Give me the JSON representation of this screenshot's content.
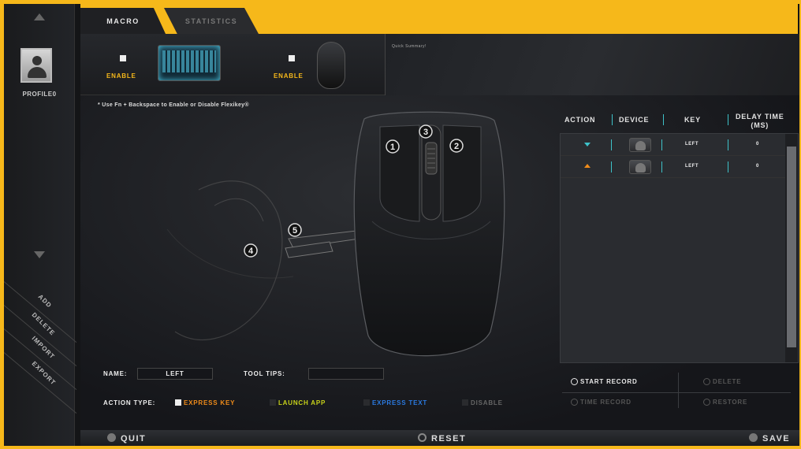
{
  "tabs": {
    "macro": "MACRO",
    "statistics": "STATISTICS"
  },
  "sidebar": {
    "profile_label": "PROFILE0",
    "actions": {
      "add": "ADD",
      "delete": "DELETE",
      "import": "IMPORT",
      "export": "EXPORT"
    }
  },
  "devices": {
    "keyboard_enable": "ENABLE",
    "mouse_enable": "ENABLE"
  },
  "summary": {
    "label": "Quick Summary!"
  },
  "hint": "* Use Fn + Backspace to Enable or Disable Flexikey®",
  "mouse_buttons": [
    "1",
    "2",
    "3",
    "4",
    "5"
  ],
  "table": {
    "headers": {
      "action": "ACTION",
      "device": "DEVICE",
      "key": "KEY",
      "delay_line1": "DELAY TIME",
      "delay_line2": "(MS)"
    },
    "rows": [
      {
        "action": "down",
        "key": "LEFT",
        "delay": "0"
      },
      {
        "action": "up",
        "key": "LEFT",
        "delay": "0"
      }
    ]
  },
  "record": {
    "start_record": "START RECORD",
    "time_record": "TIME RECORD",
    "delete": "DELETE",
    "restore": "RESTORE"
  },
  "form": {
    "name_label": "NAME:",
    "name_value": "LEFT",
    "tooltips_label": "TOOL TIPS:",
    "tooltips_value": "",
    "action_type_label": "ACTION TYPE:",
    "action_types": [
      "EXPRESS KEY",
      "LAUNCH APP",
      "EXPRESS TEXT",
      "DISABLE"
    ]
  },
  "footer": {
    "quit": "QUIT",
    "reset": "RESET",
    "save": "SAVE"
  },
  "colors": {
    "accent": "#f6b81a",
    "express_key": "#f08c1a",
    "launch_app": "#c8d21a",
    "express_text": "#2a7ae0",
    "disable": "#666666",
    "table_sep": "#3ec2c9"
  }
}
